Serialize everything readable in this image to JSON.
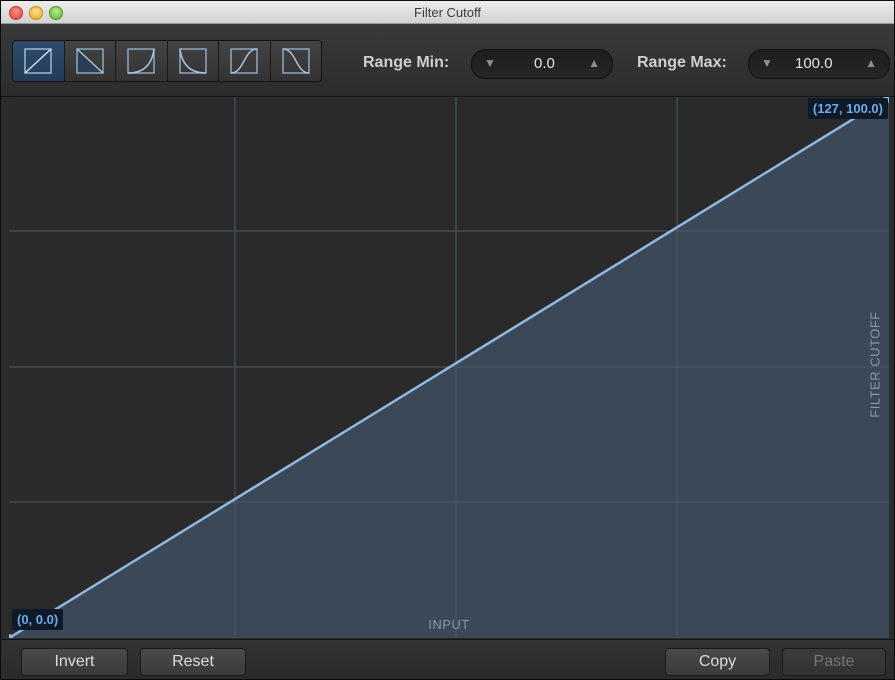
{
  "window": {
    "title": "Filter Cutoff"
  },
  "toolbar": {
    "curve_buttons": [
      {
        "icon": "linear-up-curve-icon",
        "active": true
      },
      {
        "icon": "linear-down-curve-icon",
        "active": false
      },
      {
        "icon": "exp-up-curve-icon",
        "active": false
      },
      {
        "icon": "exp-down-curve-icon",
        "active": false
      },
      {
        "icon": "s-curve-up-icon",
        "active": false
      },
      {
        "icon": "s-curve-down-icon",
        "active": false
      }
    ],
    "range_min": {
      "label": "Range Min:",
      "value": "0.0"
    },
    "range_max": {
      "label": "Range Max:",
      "value": "100.0"
    }
  },
  "graph": {
    "start_point": "(0, 0.0)",
    "end_point": "(127, 100.0)",
    "x_axis_label": "INPUT",
    "y_axis_label": "FILTER CUTOFF",
    "curve_color": "#8fb8e3",
    "fill_color": "#3c4a5a"
  },
  "buttons": {
    "invert": "Invert",
    "reset": "Reset",
    "copy": "Copy",
    "paste": "Paste"
  }
}
